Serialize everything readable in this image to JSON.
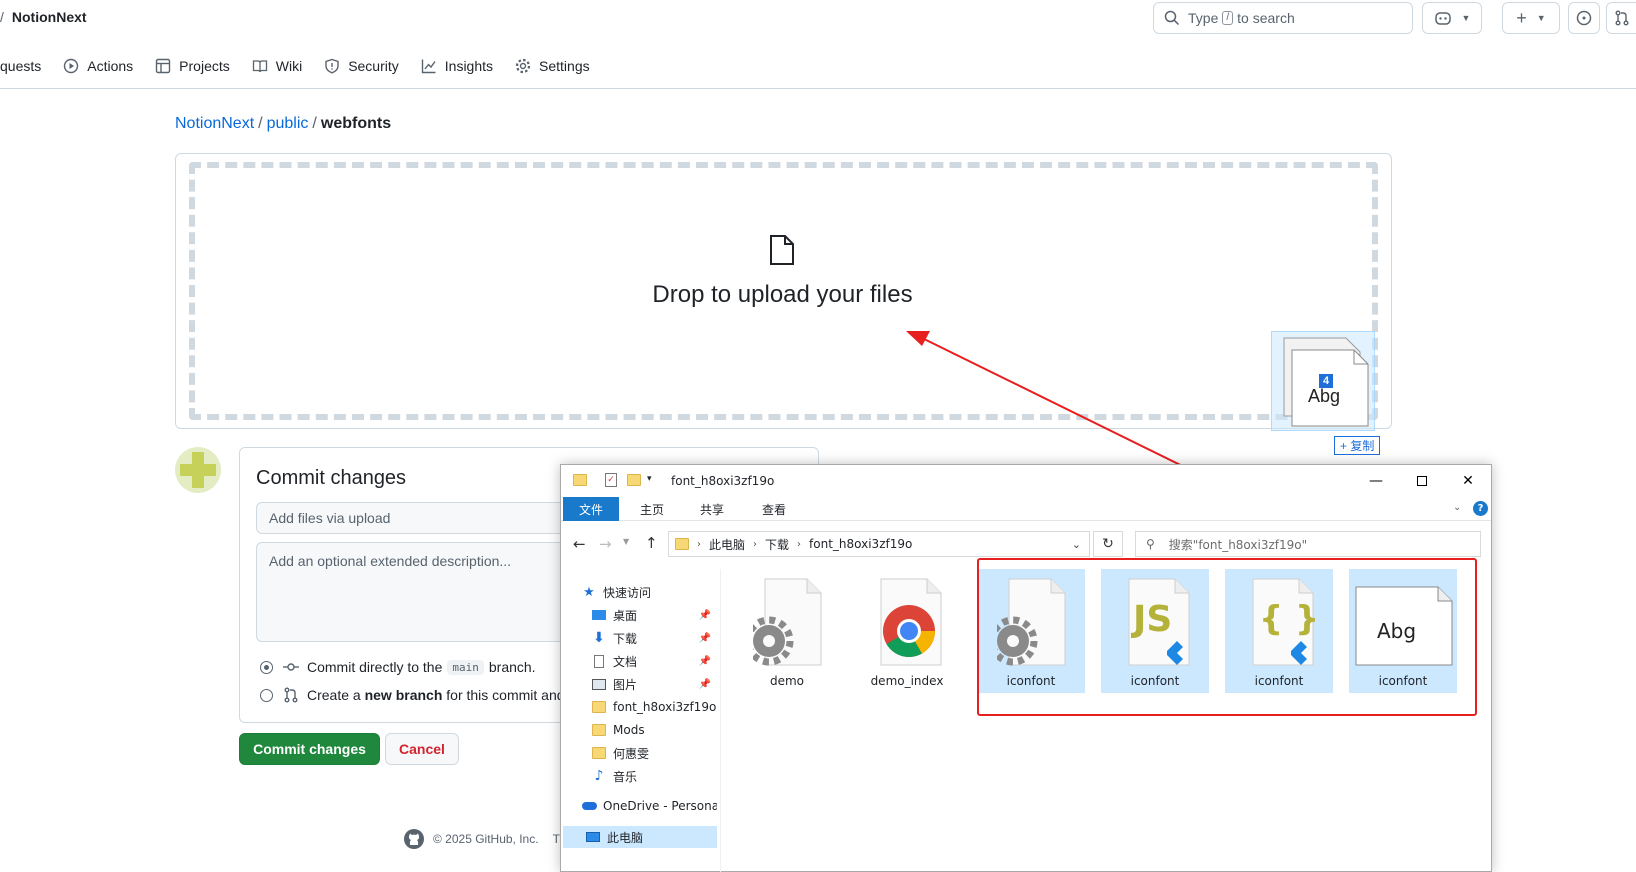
{
  "header": {
    "repo_name": "NotionNext",
    "search_placeholder_pre": "Type",
    "search_key": "/",
    "search_placeholder_post": "to search"
  },
  "nav": {
    "items": [
      {
        "label": "quests",
        "icon": "pull-request-icon"
      },
      {
        "label": "Actions",
        "icon": "play-icon"
      },
      {
        "label": "Projects",
        "icon": "table-icon"
      },
      {
        "label": "Wiki",
        "icon": "book-icon"
      },
      {
        "label": "Security",
        "icon": "shield-icon"
      },
      {
        "label": "Insights",
        "icon": "graph-icon"
      },
      {
        "label": "Settings",
        "icon": "gear-icon"
      }
    ]
  },
  "breadcrumb": {
    "repo": "NotionNext",
    "folder": "public",
    "current": "webfonts",
    "separator": "/"
  },
  "dropzone": {
    "text": "Drop to upload your files"
  },
  "drag": {
    "count": "4",
    "preview_text": "Abg",
    "copy_label": "+ 复制"
  },
  "commit": {
    "title": "Commit changes",
    "summary_placeholder": "Add files via upload",
    "description_placeholder": "Add an optional extended description...",
    "option_direct_pre": "Commit directly to the",
    "option_direct_branch": "main",
    "option_direct_post": "branch.",
    "option_new_pre": "Create a",
    "option_new_bold": "new branch",
    "option_new_post": "for this commit and",
    "commit_button": "Commit changes",
    "cancel_button": "Cancel"
  },
  "footer": {
    "copyright": "© 2025 GitHub, Inc.",
    "trailing": "T"
  },
  "explorer": {
    "title": "font_h8oxi3zf19o",
    "ribbon_tabs": [
      "文件",
      "主页",
      "共享",
      "查看"
    ],
    "address": [
      "此电脑",
      "下载",
      "font_h8oxi3zf19o"
    ],
    "search_placeholder": "搜索\"font_h8oxi3zf19o\"",
    "nav_items": [
      {
        "label": "快速访问",
        "icon": "star-icon",
        "pinned": false
      },
      {
        "label": "桌面",
        "icon": "desktop-icon",
        "pinned": true
      },
      {
        "label": "下载",
        "icon": "download-icon",
        "pinned": true
      },
      {
        "label": "文档",
        "icon": "document-icon",
        "pinned": true
      },
      {
        "label": "图片",
        "icon": "picture-icon",
        "pinned": true
      },
      {
        "label": "font_h8oxi3zf19o",
        "icon": "folder-icon",
        "pinned": false
      },
      {
        "label": "Mods",
        "icon": "folder-icon",
        "pinned": false
      },
      {
        "label": "何惠雯",
        "icon": "folder-icon",
        "pinned": false
      },
      {
        "label": "音乐",
        "icon": "music-icon",
        "pinned": false
      },
      {
        "label": "OneDrive - Persona",
        "icon": "cloud-icon",
        "pinned": false
      },
      {
        "label": "此电脑",
        "icon": "computer-icon",
        "pinned": false
      }
    ],
    "files": [
      {
        "name": "demo",
        "kind": "settings-file-icon",
        "selected": false
      },
      {
        "name": "demo_index",
        "kind": "chrome-icon",
        "selected": false
      },
      {
        "name": "iconfont",
        "kind": "settings-file-icon",
        "selected": true
      },
      {
        "name": "iconfont",
        "kind": "js-file-icon",
        "selected": true
      },
      {
        "name": "iconfont",
        "kind": "json-file-icon",
        "selected": true
      },
      {
        "name": "iconfont",
        "kind": "font-file-icon",
        "selected": true
      }
    ],
    "js_glyph": "JS",
    "json_glyph": "{ }",
    "font_glyph": "Abg"
  },
  "colors": {
    "accent": "#0969da",
    "commit_green": "#1f883d",
    "cancel_red": "#d1242f",
    "annotation_red": "#e81f1f",
    "explorer_select": "#cce8ff"
  }
}
